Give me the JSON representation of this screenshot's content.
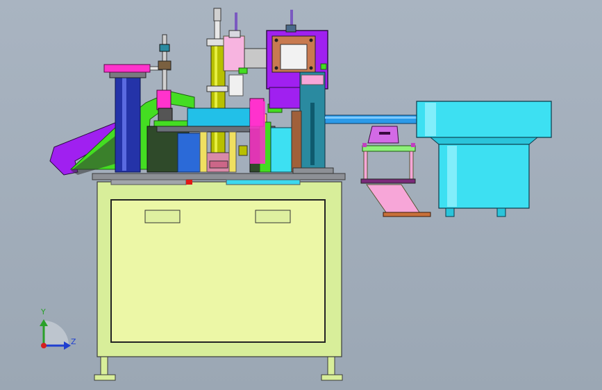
{
  "view": {
    "title": "",
    "background_color": "#9ba7b4"
  },
  "axis_triad": {
    "y_label": "Y",
    "z_label": "Z",
    "y_color": "#2aa02a",
    "z_color": "#1f3fd0",
    "x_color": "#d42020"
  },
  "colors": {
    "frame_body": "#d8ee9a",
    "frame_outline": "#3a3a3a",
    "table_top": "#8d9096",
    "bowl_feeder": "#3de0f2",
    "purple": "#a020f0",
    "magenta": "#ff33cc",
    "green": "#44dd22",
    "cyan": "#22c0e8",
    "navy": "#2433a8",
    "olive": "#b8c000",
    "yellow": "#f0e060",
    "steel": "#2a8aa0",
    "brown_plate": "#c8703a"
  }
}
